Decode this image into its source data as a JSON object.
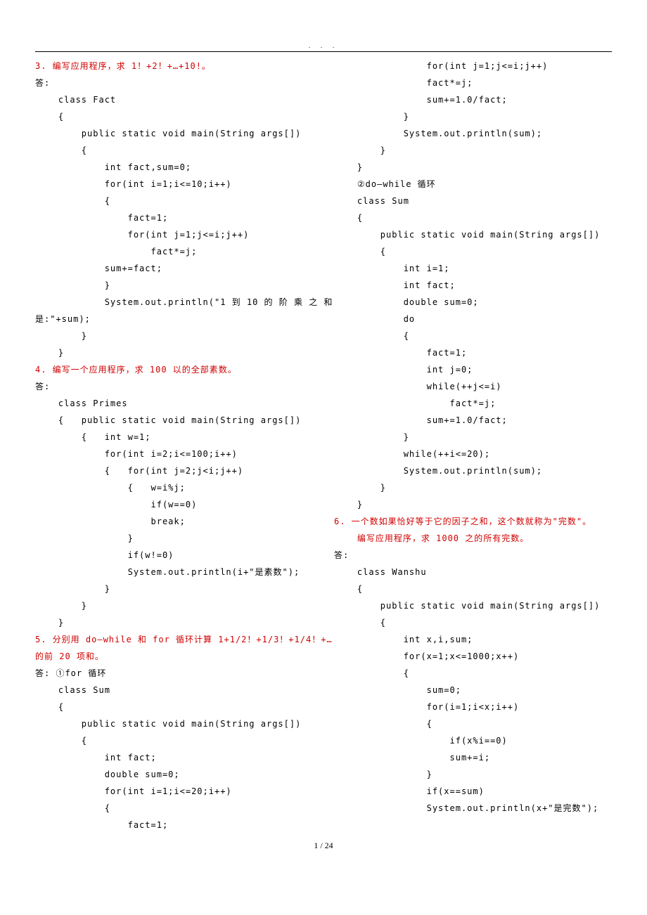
{
  "header_dots": ". . .",
  "page_number": "1 / 24",
  "lines": [
    {
      "t": "3. 编写应用程序，求 1！+2！+…+10!。",
      "red": true,
      "i": 0
    },
    {
      "t": "答:",
      "i": 0
    },
    {
      "t": "class Fact",
      "i": 1
    },
    {
      "t": "{",
      "i": 1
    },
    {
      "t": "public static void main(String args[])",
      "i": 2
    },
    {
      "t": "{",
      "i": 2
    },
    {
      "t": "int fact,sum=0;",
      "i": 3
    },
    {
      "t": "for(int i=1;i<=10;i++)",
      "i": 3
    },
    {
      "t": "{",
      "i": 3
    },
    {
      "t": "fact=1;",
      "i": 4
    },
    {
      "t": "for(int j=1;j<=i;j++)",
      "i": 4
    },
    {
      "t": "fact*=j;",
      "i": 5
    },
    {
      "t": "sum+=fact;",
      "i": 3
    },
    {
      "t": "}",
      "i": 3
    },
    {
      "t": "System.out.println(\"1 到 10 的 阶 乘 之 和",
      "i": 3
    },
    {
      "t": "是:\"+sum);",
      "i": 0
    },
    {
      "t": "}",
      "i": 2
    },
    {
      "t": "}",
      "i": 1
    },
    {
      "t": "4. 编写一个应用程序，求 100 以的全部素数。",
      "red": true,
      "i": 0
    },
    {
      "t": "答:",
      "i": 0
    },
    {
      "t": "class Primes",
      "i": 1
    },
    {
      "t": "{   public static void main(String args[])",
      "i": 1
    },
    {
      "t": "{   int w=1;",
      "i": 2
    },
    {
      "t": "for(int i=2;i<=100;i++)",
      "i": 3
    },
    {
      "t": "{   for(int j=2;j<i;j++)",
      "i": 3
    },
    {
      "t": "{   w=i%j;",
      "i": 4
    },
    {
      "t": "if(w==0)",
      "i": 5
    },
    {
      "t": "break;",
      "i": 5
    },
    {
      "t": "}",
      "i": 4
    },
    {
      "t": "if(w!=0)",
      "i": 4
    },
    {
      "t": "System.out.println(i+\"是素数\");",
      "i": 4
    },
    {
      "t": "}",
      "i": 3
    },
    {
      "t": "}",
      "i": 2
    },
    {
      "t": "}",
      "i": 1
    },
    {
      "t": "5. 分别用 do—while 和 for 循环计算 1+1/2！+1/3！+1/4！+…",
      "red": true,
      "i": 0
    },
    {
      "t": "的前 20 项和。",
      "red": true,
      "i": 0
    },
    {
      "t": "答: ①for 循环",
      "i": 0
    },
    {
      "t": "class Sum",
      "i": 1
    },
    {
      "t": "{",
      "i": 1
    },
    {
      "t": "public static void main(String args[])",
      "i": 2
    },
    {
      "t": "{",
      "i": 2
    },
    {
      "t": "int fact;",
      "i": 3
    },
    {
      "t": "double sum=0;",
      "i": 3
    },
    {
      "t": "for(int i=1;i<=20;i++)",
      "i": 3
    },
    {
      "t": "{",
      "i": 3
    },
    {
      "t": "fact=1;",
      "i": 4
    },
    {
      "t": "for(int j=1;j<=i;j++)",
      "i": 4
    },
    {
      "t": "fact*=j;",
      "i": 4
    },
    {
      "t": "sum+=1.0/fact;",
      "i": 4
    },
    {
      "t": "}",
      "i": 3
    },
    {
      "t": "System.out.println(sum);",
      "i": 3
    },
    {
      "t": "}",
      "i": 2
    },
    {
      "t": "}",
      "i": 1
    },
    {
      "t": "②do—while 循环",
      "i": 1
    },
    {
      "t": "class Sum",
      "i": 1
    },
    {
      "t": "{",
      "i": 1
    },
    {
      "t": "public static void main(String args[])",
      "i": 2
    },
    {
      "t": "{",
      "i": 2
    },
    {
      "t": "int i=1;",
      "i": 3
    },
    {
      "t": "int fact;",
      "i": 3
    },
    {
      "t": "double sum=0;",
      "i": 3
    },
    {
      "t": "do",
      "i": 3
    },
    {
      "t": "{",
      "i": 3
    },
    {
      "t": "fact=1;",
      "i": 4
    },
    {
      "t": "int j=0;",
      "i": 4
    },
    {
      "t": "while(++j<=i)",
      "i": 4
    },
    {
      "t": "fact*=j;",
      "i": 5
    },
    {
      "t": "sum+=1.0/fact;",
      "i": 4
    },
    {
      "t": "}",
      "i": 3
    },
    {
      "t": "while(++i<=20);",
      "i": 3
    },
    {
      "t": "System.out.println(sum);",
      "i": 3
    },
    {
      "t": "}",
      "i": 2
    },
    {
      "t": "}",
      "i": 1
    },
    {
      "t": "6. 一个数如果恰好等于它的因子之和，这个数就称为\"完数\"。",
      "red": true,
      "i": 0
    },
    {
      "t": "编写应用程序，求 1000 之的所有完数。",
      "red": true,
      "i": 1
    },
    {
      "t": "答:",
      "i": 0
    },
    {
      "t": "class Wanshu",
      "i": 1
    },
    {
      "t": "",
      "i": 0
    },
    {
      "t": "{",
      "i": 1
    },
    {
      "t": "public static void main(String args[])",
      "i": 2
    },
    {
      "t": "{",
      "i": 2
    },
    {
      "t": "int x,i,sum;",
      "i": 3
    },
    {
      "t": "for(x=1;x<=1000;x++)",
      "i": 3
    },
    {
      "t": "{",
      "i": 3
    },
    {
      "t": "sum=0;",
      "i": 4
    },
    {
      "t": "for(i=1;i<x;i++)",
      "i": 4
    },
    {
      "t": "{",
      "i": 4
    },
    {
      "t": "if(x%i==0)",
      "i": 5
    },
    {
      "t": "sum+=i;",
      "i": 5
    },
    {
      "t": "}",
      "i": 4
    },
    {
      "t": "if(x==sum)",
      "i": 4
    },
    {
      "t": "System.out.println(x+\"是完数\");",
      "i": 4
    }
  ]
}
